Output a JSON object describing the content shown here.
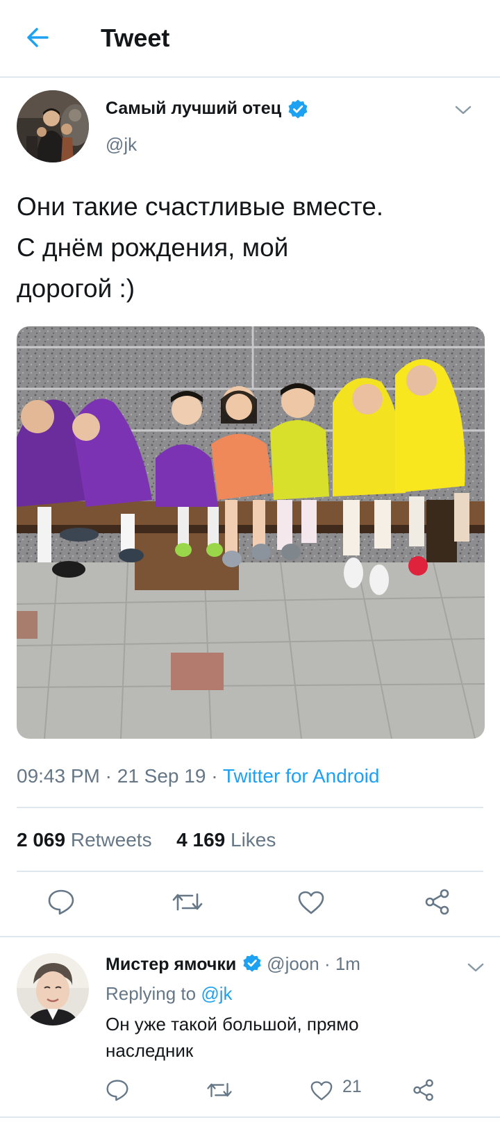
{
  "header": {
    "title": "Tweet"
  },
  "tweet": {
    "author_name": "Самый лучший отец",
    "author_handle": "@jk",
    "text_lines": [
      "Они такие счастливые вместе.",
      "С днём рождения, мой",
      "дорогой :)"
    ],
    "time": "09:43 PM",
    "date": "21 Sep 19",
    "source": "Twitter for Android",
    "retweets": "2 069",
    "retweets_label": "Retweets",
    "likes": "4 169",
    "likes_label": "Likes"
  },
  "reply": {
    "author_name": "Мистер ямочки",
    "author_handle": "@joon",
    "time": "1m",
    "replying_to_label": "Replying to",
    "replying_to_handle": "@jk",
    "text": "Он уже такой большой, прямо наследник",
    "like_count": "21"
  },
  "colors": {
    "accent": "#1da1f2",
    "secondary_text": "#657786",
    "divider": "#e1e8ed"
  },
  "icons": [
    "back-arrow-icon",
    "verified-icon",
    "chevron-down-icon",
    "reply-icon",
    "retweet-icon",
    "like-icon",
    "share-icon"
  ]
}
